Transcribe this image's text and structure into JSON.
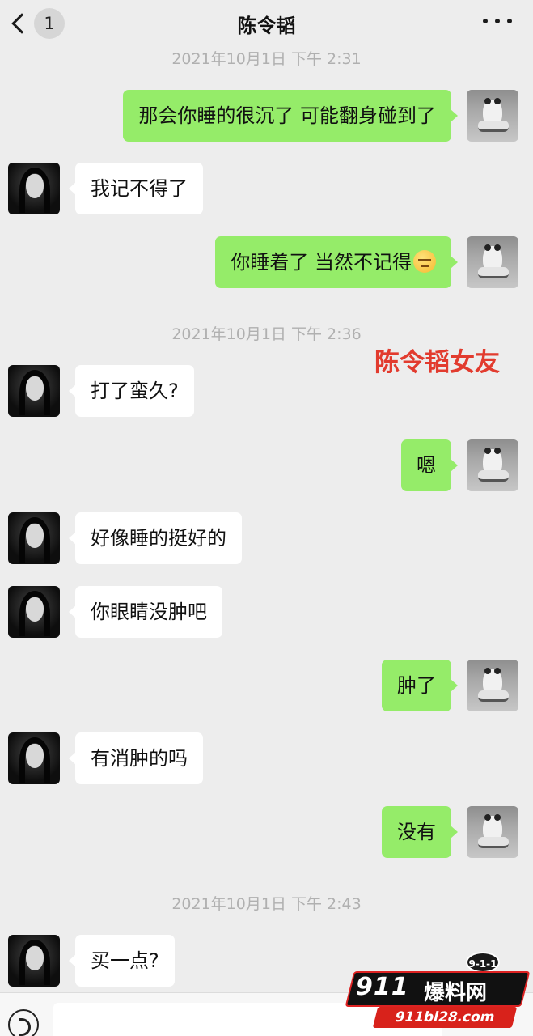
{
  "header": {
    "back_badge": "1",
    "title": "陈令韬"
  },
  "timestamps": {
    "t1": "2021年10月1日 下午 2:31",
    "t2": "2021年10月1日 下午 2:36",
    "t3": "2021年10月1日 下午 2:43"
  },
  "caption": "陈令韬女友",
  "messages": [
    {
      "side": "out",
      "text": "那会你睡的很沉了 可能翻身碰到了"
    },
    {
      "side": "in",
      "text": "我记不得了"
    },
    {
      "side": "out",
      "text": "你睡着了 当然不记得",
      "emoji": "unamused-face"
    },
    {
      "side": "in",
      "text": "打了蛮久?"
    },
    {
      "side": "out",
      "text": "嗯"
    },
    {
      "side": "in",
      "text": "好像睡的挺好的"
    },
    {
      "side": "in",
      "text": "你眼睛没肿吧"
    },
    {
      "side": "out",
      "text": "肿了"
    },
    {
      "side": "in",
      "text": "有消肿的吗"
    },
    {
      "side": "out",
      "text": "没有"
    },
    {
      "side": "in",
      "text": "买一点?"
    }
  ],
  "watermark": {
    "badge": "9-1-1",
    "number": "911",
    "name": "爆料网",
    "site": "911bl28.com"
  },
  "colors": {
    "background": "#ededed",
    "outgoing_bubble": "#95ec69",
    "incoming_bubble": "#ffffff",
    "caption": "#e23b2e"
  }
}
